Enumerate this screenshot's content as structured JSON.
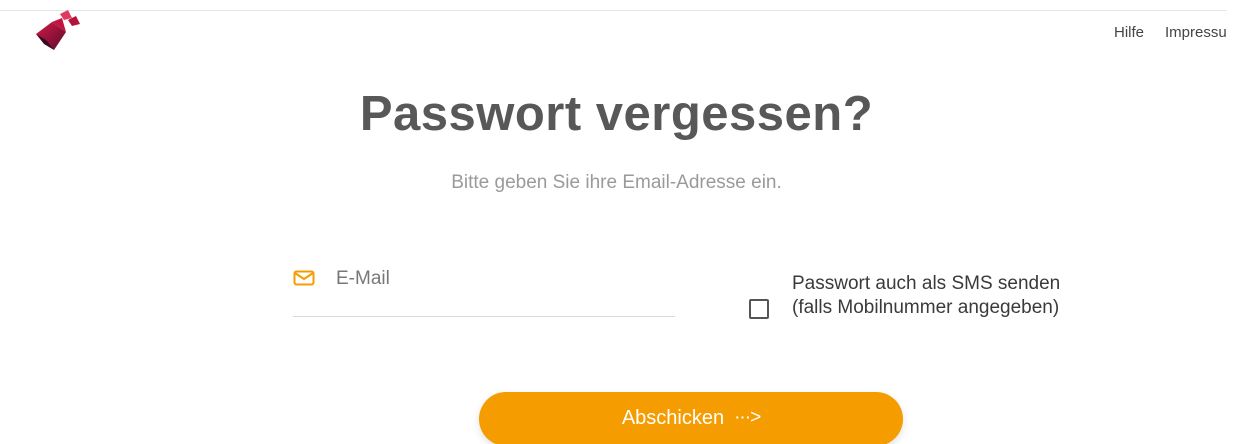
{
  "header": {
    "nav": [
      {
        "label": "Hilfe"
      },
      {
        "label": "Impressum"
      }
    ]
  },
  "main": {
    "title": "Passwort vergessen?",
    "subtitle": "Bitte geben Sie ihre Email-Adresse ein.",
    "email_field": {
      "placeholder": "E-Mail",
      "value": "",
      "icon": "mail-icon"
    },
    "sms_option": {
      "label": "Passwort auch als SMS senden (falls Mobilnummer angegeben)",
      "checked": false
    },
    "submit": {
      "label": "Abschicken",
      "arrow": "···>"
    }
  },
  "colors": {
    "accent": "#f59c00",
    "title": "#585858",
    "subtitle": "#9a9a9a",
    "logo": "#b3123c"
  }
}
